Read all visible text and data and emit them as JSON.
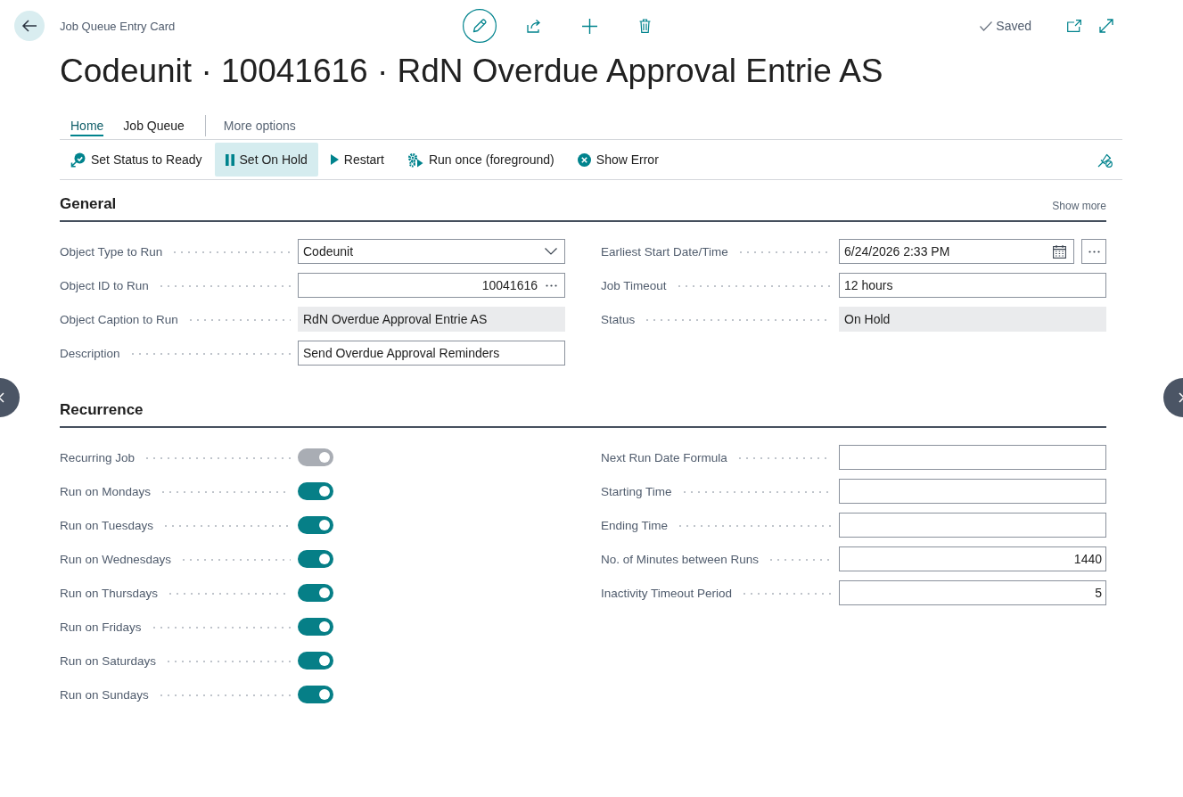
{
  "header": {
    "breadcrumb": "Job Queue Entry Card",
    "save_status": "Saved"
  },
  "title": "Codeunit · 10041616 · RdN Overdue Approval Entrie AS",
  "tabs": [
    {
      "label": "Home",
      "selected": true
    },
    {
      "label": "Job Queue",
      "selected": false
    }
  ],
  "more_options": "More options",
  "actions": [
    {
      "label": "Set Status to Ready",
      "kind": "ready",
      "selected": false
    },
    {
      "label": "Set On Hold",
      "kind": "hold",
      "selected": true
    },
    {
      "label": "Restart",
      "kind": "restart",
      "selected": false
    },
    {
      "label": "Run once (foreground)",
      "kind": "run",
      "selected": false
    },
    {
      "label": "Show Error",
      "kind": "error",
      "selected": false
    }
  ],
  "sections": [
    {
      "title": "General",
      "show_more": "Show more",
      "left": [
        {
          "label": "Object Type to Run",
          "kind": "dropdown",
          "value": "Codeunit"
        },
        {
          "label": "Object ID to Run",
          "kind": "lookup",
          "value": "10041616"
        },
        {
          "label": "Object Caption to Run",
          "kind": "readonly",
          "value": "RdN Overdue Approval Entrie AS"
        },
        {
          "label": "Description",
          "kind": "text",
          "value": "Send Overdue Approval Reminders"
        }
      ],
      "right": [
        {
          "label": "Earliest Start Date/Time",
          "kind": "datetime",
          "value": "6/24/2026 2:33 PM"
        },
        {
          "label": "Job Timeout",
          "kind": "text",
          "value": "12 hours"
        },
        {
          "label": "Status",
          "kind": "readonly",
          "value": "On Hold"
        }
      ]
    },
    {
      "title": "Recurrence",
      "left": [
        {
          "label": "Recurring Job",
          "kind": "toggle",
          "on": true,
          "disabled": true
        },
        {
          "label": "Run on Mondays",
          "kind": "toggle",
          "on": true,
          "disabled": false
        },
        {
          "label": "Run on Tuesdays",
          "kind": "toggle",
          "on": true,
          "disabled": false
        },
        {
          "label": "Run on Wednesdays",
          "kind": "toggle",
          "on": true,
          "disabled": false
        },
        {
          "label": "Run on Thursdays",
          "kind": "toggle",
          "on": true,
          "disabled": false
        },
        {
          "label": "Run on Fridays",
          "kind": "toggle",
          "on": true,
          "disabled": false
        },
        {
          "label": "Run on Saturdays",
          "kind": "toggle",
          "on": true,
          "disabled": false
        },
        {
          "label": "Run on Sundays",
          "kind": "toggle",
          "on": true,
          "disabled": false
        }
      ],
      "right": [
        {
          "label": "Next Run Date Formula",
          "kind": "text"
        },
        {
          "label": "Starting Time",
          "kind": "text"
        },
        {
          "label": "Ending Time",
          "kind": "text"
        },
        {
          "label": "No. of Minutes between Runs",
          "kind": "number",
          "value": "1440"
        },
        {
          "label": "Inactivity Timeout Period",
          "kind": "number",
          "value": "5"
        }
      ]
    }
  ]
}
